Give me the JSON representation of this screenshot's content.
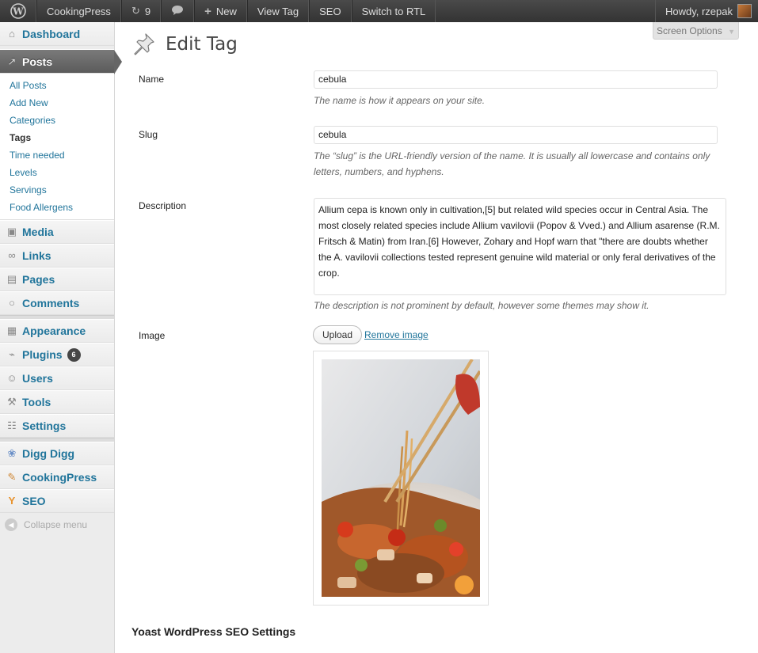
{
  "adminbar": {
    "site_name": "CookingPress",
    "updates_count": "9",
    "new_label": "New",
    "view_tag_label": "View Tag",
    "seo_label": "SEO",
    "rtl_label": "Switch to RTL",
    "howdy": "Howdy, rzepak"
  },
  "sidebar": {
    "dashboard": "Dashboard",
    "posts": "Posts",
    "posts_sub": [
      "All Posts",
      "Add New",
      "Categories",
      "Tags",
      "Time needed",
      "Levels",
      "Servings",
      "Food Allergens"
    ],
    "media": "Media",
    "links": "Links",
    "pages": "Pages",
    "comments": "Comments",
    "appearance": "Appearance",
    "plugins": "Plugins",
    "plugins_badge": "6",
    "users": "Users",
    "tools": "Tools",
    "settings": "Settings",
    "digg": "Digg Digg",
    "cookingpress": "CookingPress",
    "seo": "SEO",
    "collapse": "Collapse menu"
  },
  "screen_options": "Screen Options",
  "page_title": "Edit Tag",
  "form": {
    "name_label": "Name",
    "name_value": "cebula",
    "name_desc": "The name is how it appears on your site.",
    "slug_label": "Slug",
    "slug_value": "cebula",
    "slug_desc_1": "The “slug” is the URL-friendly version of the name. It is usually all lowercase and contains only",
    "slug_desc_2": "letters, numbers, and hyphens.",
    "description_label": "Description",
    "description_value": "Allium cepa is known only in cultivation,[5] but related wild species occur in Central Asia. The most closely related species include Allium vavilovii (Popov & Vved.) and Allium asarense (R.M. Fritsch & Matin) from Iran.[6] However, Zohary and Hopf warn that \"there are doubts whether the A. vavilovii collections tested represent genuine wild material or only feral derivatives of the crop.",
    "description_desc": "The description is not prominent by default, however some themes may show it.",
    "image_label": "Image",
    "upload_label": "Upload",
    "remove_label": "Remove image"
  },
  "yoast_heading": "Yoast WordPress SEO Settings"
}
